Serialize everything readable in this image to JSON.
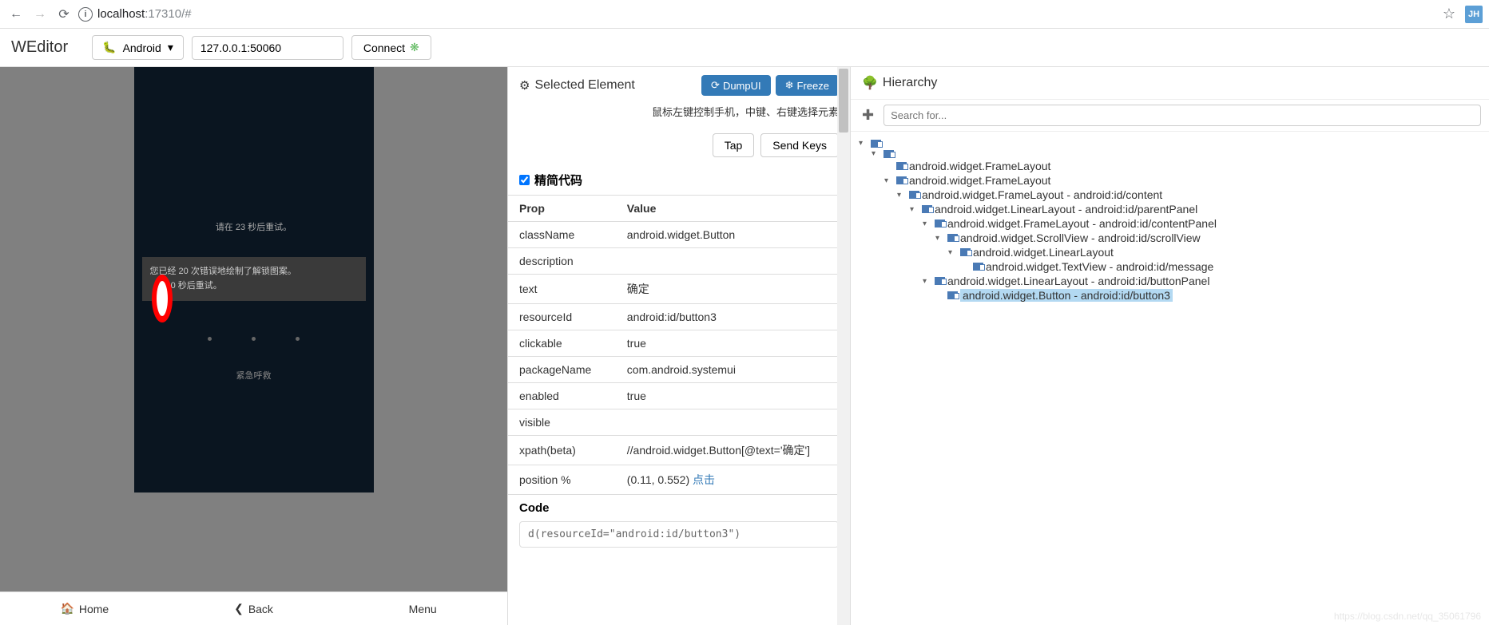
{
  "browser": {
    "url_host": "localhost",
    "url_port": ":17310",
    "url_path": "/#",
    "profile": "JH"
  },
  "toolbar": {
    "logo": "WEditor",
    "platform": "Android",
    "host": "127.0.0.1:50060",
    "connect": "Connect"
  },
  "device": {
    "wait_text": "请在 23 秒后重试。",
    "dialog_line1": "您已经 20 次错误地绘制了解锁图案。",
    "dialog_line2": "30 秒后重试。",
    "emergency": "紧急呼救",
    "nav_home": "Home",
    "nav_back": "Back",
    "nav_menu": "Menu"
  },
  "selected": {
    "title": "Selected Element",
    "dump": "DumpUI",
    "freeze": "Freeze",
    "hint": "鼠标左键控制手机，中键、右键选择元素",
    "tap": "Tap",
    "sendkeys": "Send Keys",
    "simplify": "精简代码",
    "th_prop": "Prop",
    "th_value": "Value",
    "props": {
      "className_k": "className",
      "className_v": "android.widget.Button",
      "description_k": "description",
      "description_v": "",
      "text_k": "text",
      "text_v": "确定",
      "resourceId_k": "resourceId",
      "resourceId_v": "android:id/button3",
      "clickable_k": "clickable",
      "clickable_v": "true",
      "packageName_k": "packageName",
      "packageName_v": "com.android.systemui",
      "enabled_k": "enabled",
      "enabled_v": "true",
      "visible_k": "visible",
      "visible_v": "",
      "xpath_k": "xpath(beta)",
      "xpath_v": "//android.widget.Button[@text='确定']",
      "position_k": "position %",
      "position_v": "(0.11, 0.552) ",
      "position_link": "点击"
    },
    "code_header": "Code",
    "code": "d(resourceId=\"android:id/button3\")"
  },
  "hierarchy": {
    "title": "Hierarchy",
    "search_placeholder": "Search for...",
    "nodes": [
      {
        "indent": 0,
        "toggle": "▾",
        "label": ""
      },
      {
        "indent": 1,
        "toggle": "▾",
        "label": ""
      },
      {
        "indent": 2,
        "toggle": "",
        "label": "android.widget.FrameLayout"
      },
      {
        "indent": 2,
        "toggle": "▾",
        "label": "android.widget.FrameLayout"
      },
      {
        "indent": 3,
        "toggle": "▾",
        "label": "android.widget.FrameLayout - android:id/content"
      },
      {
        "indent": 4,
        "toggle": "▾",
        "label": "android.widget.LinearLayout - android:id/parentPanel"
      },
      {
        "indent": 5,
        "toggle": "▾",
        "label": "android.widget.FrameLayout - android:id/contentPanel"
      },
      {
        "indent": 6,
        "toggle": "▾",
        "label": "android.widget.ScrollView - android:id/scrollView"
      },
      {
        "indent": 7,
        "toggle": "▾",
        "label": "android.widget.LinearLayout"
      },
      {
        "indent": 8,
        "toggle": "",
        "label": "android.widget.TextView - android:id/message"
      },
      {
        "indent": 5,
        "toggle": "▾",
        "label": "android.widget.LinearLayout - android:id/buttonPanel"
      },
      {
        "indent": 6,
        "toggle": "",
        "label": "android.widget.Button - android:id/button3",
        "selected": true
      }
    ]
  }
}
